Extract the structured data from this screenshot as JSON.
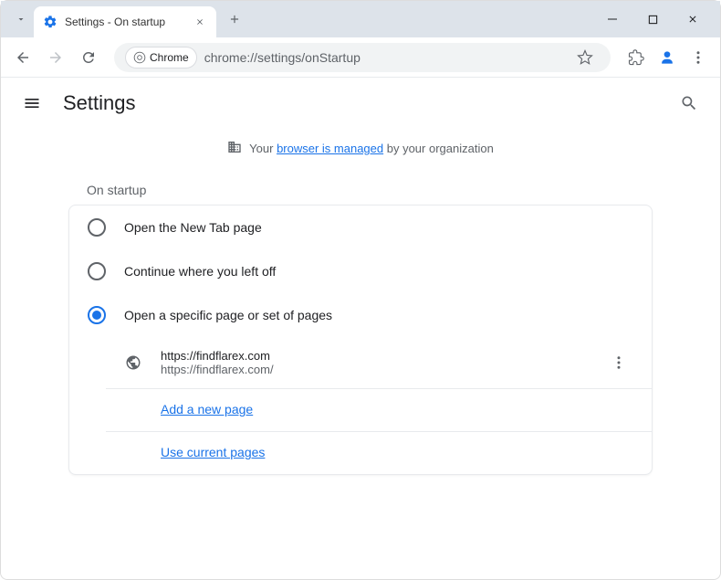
{
  "titlebar": {
    "tab_title": "Settings - On startup"
  },
  "urlbar": {
    "chip": "Chrome",
    "url": "chrome://settings/onStartup"
  },
  "header": {
    "title": "Settings"
  },
  "managed": {
    "prefix": "Your ",
    "link": "browser is managed",
    "suffix": " by your organization"
  },
  "section": {
    "title": "On startup",
    "options": [
      {
        "label": "Open the New Tab page"
      },
      {
        "label": "Continue where you left off"
      },
      {
        "label": "Open a specific page or set of pages"
      }
    ],
    "pages": [
      {
        "name": "https://findflarex.com",
        "url": "https://findflarex.com/"
      }
    ],
    "add_page": "Add a new page",
    "use_current": "Use current pages"
  }
}
